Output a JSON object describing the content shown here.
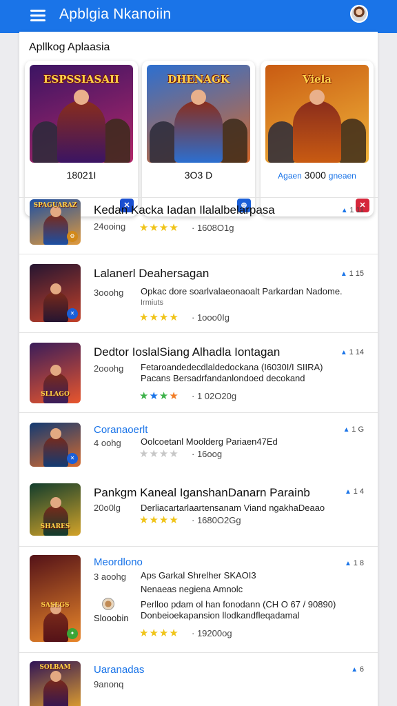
{
  "appbar": {
    "title": "Apblgia Nkanoiin",
    "menu_icon": "hamburger-menu-icon",
    "avatar": "user-avatar"
  },
  "section_title": "Apllkog Aplaasia",
  "featured": [
    {
      "art_title": "ESPSSIASAII",
      "price": "18021I",
      "accent_pre": "",
      "accent_post": "",
      "colors": [
        "#3b1463",
        "#b3286a"
      ],
      "badge": "✕",
      "badge_color": "#1a4fd1"
    },
    {
      "art_title": "DHENAGK",
      "price": "3O3 D",
      "accent_pre": "",
      "accent_post": "",
      "colors": [
        "#2c6fd0",
        "#d86a2b"
      ],
      "badge": "⊕",
      "badge_color": "#1a5fd8"
    },
    {
      "art_title": "Viela",
      "price": "3000",
      "accent_pre": "Agaen",
      "accent_post": "gneaen",
      "colors": [
        "#c95b12",
        "#f0b43a"
      ],
      "badge": "✕",
      "badge_color": "#d6263b"
    }
  ],
  "items": [
    {
      "name": "Kedan Kacka Iadan Ilalalbelarpasa",
      "name_blue": false,
      "sub": "24ooing",
      "desc": [],
      "stars": "★★★★",
      "star_color": "#f0c419",
      "downloads": "1608O1g",
      "rank": "1 11",
      "thumb_title": "SPAGUARAZ",
      "thumb_colors": [
        "#1c4fa3",
        "#e29a3b"
      ],
      "badge": "⚙",
      "badge_color": "#d2891a"
    },
    {
      "name": "Lalanerl Deahersagan",
      "name_blue": false,
      "sub": "3ooohg",
      "desc": [
        "Opkac dore soarlvalaeonaoalt Parkardan Nadome.",
        "Irmiuts"
      ],
      "stars": "★★★★",
      "star_color": "#f0c419",
      "downloads": "1ooo0Ig",
      "rank": "1 15",
      "thumb_title": "",
      "thumb_colors": [
        "#251531",
        "#c2412a"
      ],
      "badge": "✕",
      "badge_color": "#1a5fd8"
    },
    {
      "name": "Dedtor IoslalSiang Alhadla Iontagan",
      "name_blue": false,
      "sub": "2ooohg",
      "desc": [
        "Fetaroandedecdlaldedockana (I6030I/I SIIRA)",
        "Pacans Bersadrfandanlondoed decokand"
      ],
      "stars": "★★★★",
      "star_color": "#3db24a",
      "downloads": "1 02O20g",
      "rank": "1 14",
      "thumb_title": "SLLAGO",
      "thumb_colors": [
        "#3a1d5a",
        "#e8562d"
      ],
      "badge": "",
      "badge_color": ""
    },
    {
      "name": "Coranaoerlt",
      "name_blue": true,
      "sub": "4 oohg",
      "desc": [
        "Oolcoetanl Moolderg Pariaen47Ed"
      ],
      "stars": "★★★★",
      "star_color": "#c7c7c7",
      "downloads": "16oog",
      "rank": "1 G",
      "thumb_title": "",
      "thumb_colors": [
        "#123a73",
        "#d76b2e"
      ],
      "badge": "✕",
      "badge_color": "#1a5fd8"
    },
    {
      "name": "Pankgm Kaneal IganshanDanarn Parainb",
      "name_blue": false,
      "sub": "20o0lg",
      "desc": [
        "Derliacartarlaartensanam Viand ngakhaDeaao"
      ],
      "stars": "★★★★",
      "star_color": "#f0c419",
      "downloads": "1680O2Gg",
      "rank": "1 4",
      "thumb_title": "SHARES",
      "thumb_colors": [
        "#123d2d",
        "#d3a329"
      ],
      "badge": "",
      "badge_color": ""
    },
    {
      "name": "Meordlono",
      "name_blue": true,
      "sub": "3 aoohg",
      "desc": [
        "Aps Garkal Shrelher SKAOI3",
        "Nenaeas negiena Amnolc",
        "Perlloo pdam ol han fonodann (CH O 67 / 90890)",
        "Donbeioekapansion llodkandfleqadamal"
      ],
      "stars": "★★★★",
      "star_color": "#f0c419",
      "downloads": "19200og",
      "rank": "1 8",
      "studio": "Slooobin",
      "thumb_title": "SASEGS",
      "thumb_colors": [
        "#541218",
        "#e8862a"
      ],
      "badge": "✦",
      "badge_color": "#3aa537"
    },
    {
      "name": "Uaranadas",
      "name_blue": true,
      "sub": "9anonq",
      "desc": [],
      "stars": "",
      "star_color": "#f0c419",
      "downloads": "",
      "rank": "6",
      "thumb_title": "SOLBAM",
      "thumb_colors": [
        "#2f1456",
        "#e0a02f"
      ],
      "badge": "",
      "badge_color": ""
    }
  ]
}
